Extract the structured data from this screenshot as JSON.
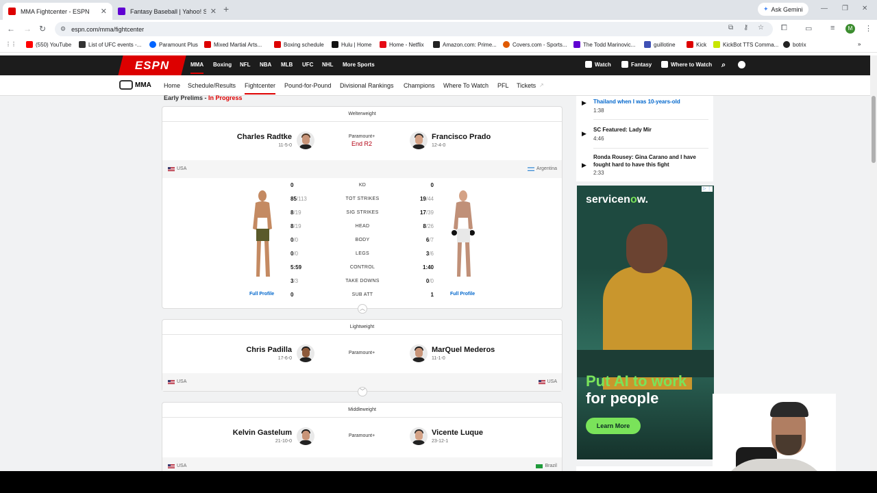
{
  "browser": {
    "tabs": [
      {
        "title": "MMA Fightcenter - ESPN",
        "active": true,
        "color": "#d00"
      },
      {
        "title": "Fantasy Baseball | Yahoo! Sports",
        "active": false,
        "color": "#6001d2"
      }
    ],
    "gemini_label": "Ask Gemini",
    "url": "espn.com/mma/fightcenter",
    "profile_initial": "M",
    "bookmarks": [
      {
        "label": "(550) YouTube",
        "color": "#ff0000"
      },
      {
        "label": "List of UFC events -...",
        "color": "#333333"
      },
      {
        "label": "Paramount Plus",
        "color": "#0064ff"
      },
      {
        "label": "Mixed Martial Arts...",
        "color": "#d00"
      },
      {
        "label": "Boxing schedule",
        "color": "#d00"
      },
      {
        "label": "Hulu | Home",
        "color": "#111111"
      },
      {
        "label": "Home - Netflix",
        "color": "#e50914"
      },
      {
        "label": "Amazon.com: Prime...",
        "color": "#222222"
      },
      {
        "label": "Covers.com - Sports...",
        "color": "#e05a00"
      },
      {
        "label": "The Todd Marinovic...",
        "color": "#6001d2"
      },
      {
        "label": "guillotine",
        "color": "#3f51b5"
      },
      {
        "label": "Kick",
        "color": "#d00"
      },
      {
        "label": "KickBot TTS Comma...",
        "color": "#c8e600"
      },
      {
        "label": "botrix",
        "color": "#222222"
      }
    ]
  },
  "espn": {
    "logo": "ESPN",
    "topnav": [
      "MMA",
      "Boxing",
      "NFL",
      "NBA",
      "MLB",
      "UFC",
      "NHL",
      "More Sports"
    ],
    "topright": [
      "Watch",
      "Fantasy",
      "Where to Watch"
    ],
    "subnav_brand": "MMA",
    "subnav": [
      "Home",
      "Schedule/Results",
      "Fightcenter",
      "Pound-for-Pound",
      "Divisional Rankings",
      "Champions",
      "Where To Watch",
      "PFL",
      "Tickets"
    ],
    "active_subnav": "Fightcenter"
  },
  "section": {
    "title": "Early Prelims",
    "separator": " - ",
    "status": "In Progress"
  },
  "fights": [
    {
      "weight_class": "Welterweight",
      "network": "Paramount+",
      "status": "End R2",
      "left": {
        "name": "Charles Radtke",
        "record": "11-5-0",
        "country": "USA"
      },
      "right": {
        "name": "Francisco Prado",
        "record": "12-4-0",
        "country": "Argentina"
      },
      "stats": [
        {
          "label": "KD",
          "l": "0",
          "l_sub": "",
          "r": "0",
          "r_sub": ""
        },
        {
          "label": "TOT STRIKES",
          "l": "85",
          "l_sub": "/113",
          "r": "19",
          "r_sub": "/44"
        },
        {
          "label": "SIG STRIKES",
          "l": "8",
          "l_sub": "/19",
          "r": "17",
          "r_sub": "/39"
        },
        {
          "label": "HEAD",
          "l": "8",
          "l_sub": "/19",
          "r": "8",
          "r_sub": "/26"
        },
        {
          "label": "BODY",
          "l": "0",
          "l_sub": "/0",
          "r": "6",
          "r_sub": "/7"
        },
        {
          "label": "LEGS",
          "l": "0",
          "l_sub": "/0",
          "r": "3",
          "r_sub": "/6"
        },
        {
          "label": "CONTROL",
          "l": "5:59",
          "l_sub": "",
          "r": "1:40",
          "r_sub": ""
        },
        {
          "label": "TAKE DOWNS",
          "l": "3",
          "l_sub": "/3",
          "r": "0",
          "r_sub": "/0"
        },
        {
          "label": "SUB ATT",
          "l": "0",
          "l_sub": "",
          "r": "1",
          "r_sub": ""
        }
      ],
      "full_profile": "Full Profile"
    },
    {
      "weight_class": "Lightweight",
      "network": "Paramount+",
      "left": {
        "name": "Chris Padilla",
        "record": "17-6-0",
        "country": "USA"
      },
      "right": {
        "name": "MarQuel Mederos",
        "record": "11-1-0",
        "country": "USA"
      }
    },
    {
      "weight_class": "Middleweight",
      "network": "Paramount+",
      "left": {
        "name": "Kelvin Gastelum",
        "record": "21-10-0",
        "country": "USA"
      },
      "right": {
        "name": "Vicente Luque",
        "record": "23-12-1",
        "country": "Brazil"
      }
    }
  ],
  "videos": [
    {
      "title_line1": "Thailand when I was 10-years-old",
      "duration": "1:38"
    },
    {
      "title": "SC Featured: Lady Mir",
      "duration": "4:46"
    },
    {
      "title_line1": "Ronda Rousey: Gina Carano and I have",
      "title_line2": "fought hard to have this fight",
      "duration": "2:33"
    }
  ],
  "ad": {
    "brand_prefix": "servicen",
    "brand_o": "o",
    "brand_suffix": "w.",
    "headline_1": "Put AI to work",
    "headline_2": "for people",
    "cta": "Learn More"
  }
}
